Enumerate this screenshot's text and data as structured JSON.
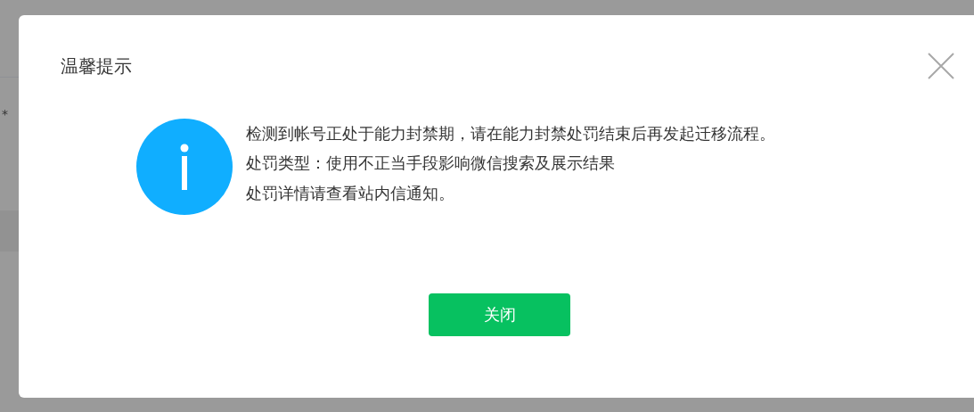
{
  "background": {
    "required_mark": "*"
  },
  "dialog": {
    "title": "温馨提示",
    "message_lines": [
      "检测到帐号正处于能力封禁期，请在能力封禁处罚结束后再发起迁移流程。",
      "处罚类型：使用不正当手段影响微信搜索及展示结果",
      "处罚详情请查看站内信通知。"
    ],
    "button": "关闭"
  }
}
